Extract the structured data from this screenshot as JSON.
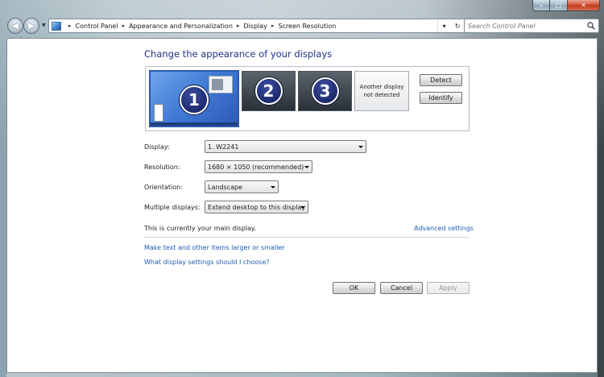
{
  "window": {
    "minimize_glyph": "–",
    "maximize_glyph": "□",
    "close_glyph": "✕"
  },
  "nav": {
    "back_glyph": "◀",
    "forward_glyph": "▶",
    "dropdown_glyph": "▼"
  },
  "address_bar": {
    "breadcrumbs": [
      "Control Panel",
      "Appearance and Personalization",
      "Display",
      "Screen Resolution"
    ],
    "separator": "▸",
    "dropdown_glyph": "▾",
    "refresh_glyph": "↻"
  },
  "search": {
    "placeholder": "Search Control Panel"
  },
  "page": {
    "title": "Change the appearance of your displays"
  },
  "monitors": {
    "m1": "1",
    "m2": "2",
    "m3": "3",
    "not_detected": "Another display not detected"
  },
  "buttons": {
    "detect": "Detect",
    "identify": "Identify",
    "ok": "OK",
    "cancel": "Cancel",
    "apply": "Apply"
  },
  "form": {
    "display_label": "Display:",
    "display_value": "1. W2241",
    "resolution_label": "Resolution:",
    "resolution_value": "1680 × 1050 (recommended)",
    "orientation_label": "Orientation:",
    "orientation_value": "Landscape",
    "multiple_label": "Multiple displays:",
    "multiple_value": "Extend desktop to this display"
  },
  "status": {
    "main_display_note": "This is currently your main display."
  },
  "links": {
    "advanced": "Advanced settings",
    "text_size": "Make text and other items larger or smaller",
    "which_settings": "What display settings should I choose?"
  },
  "colors": {
    "heading": "#1e3287",
    "link": "#1e5cb3",
    "selected_monitor": "#3f79d4"
  }
}
